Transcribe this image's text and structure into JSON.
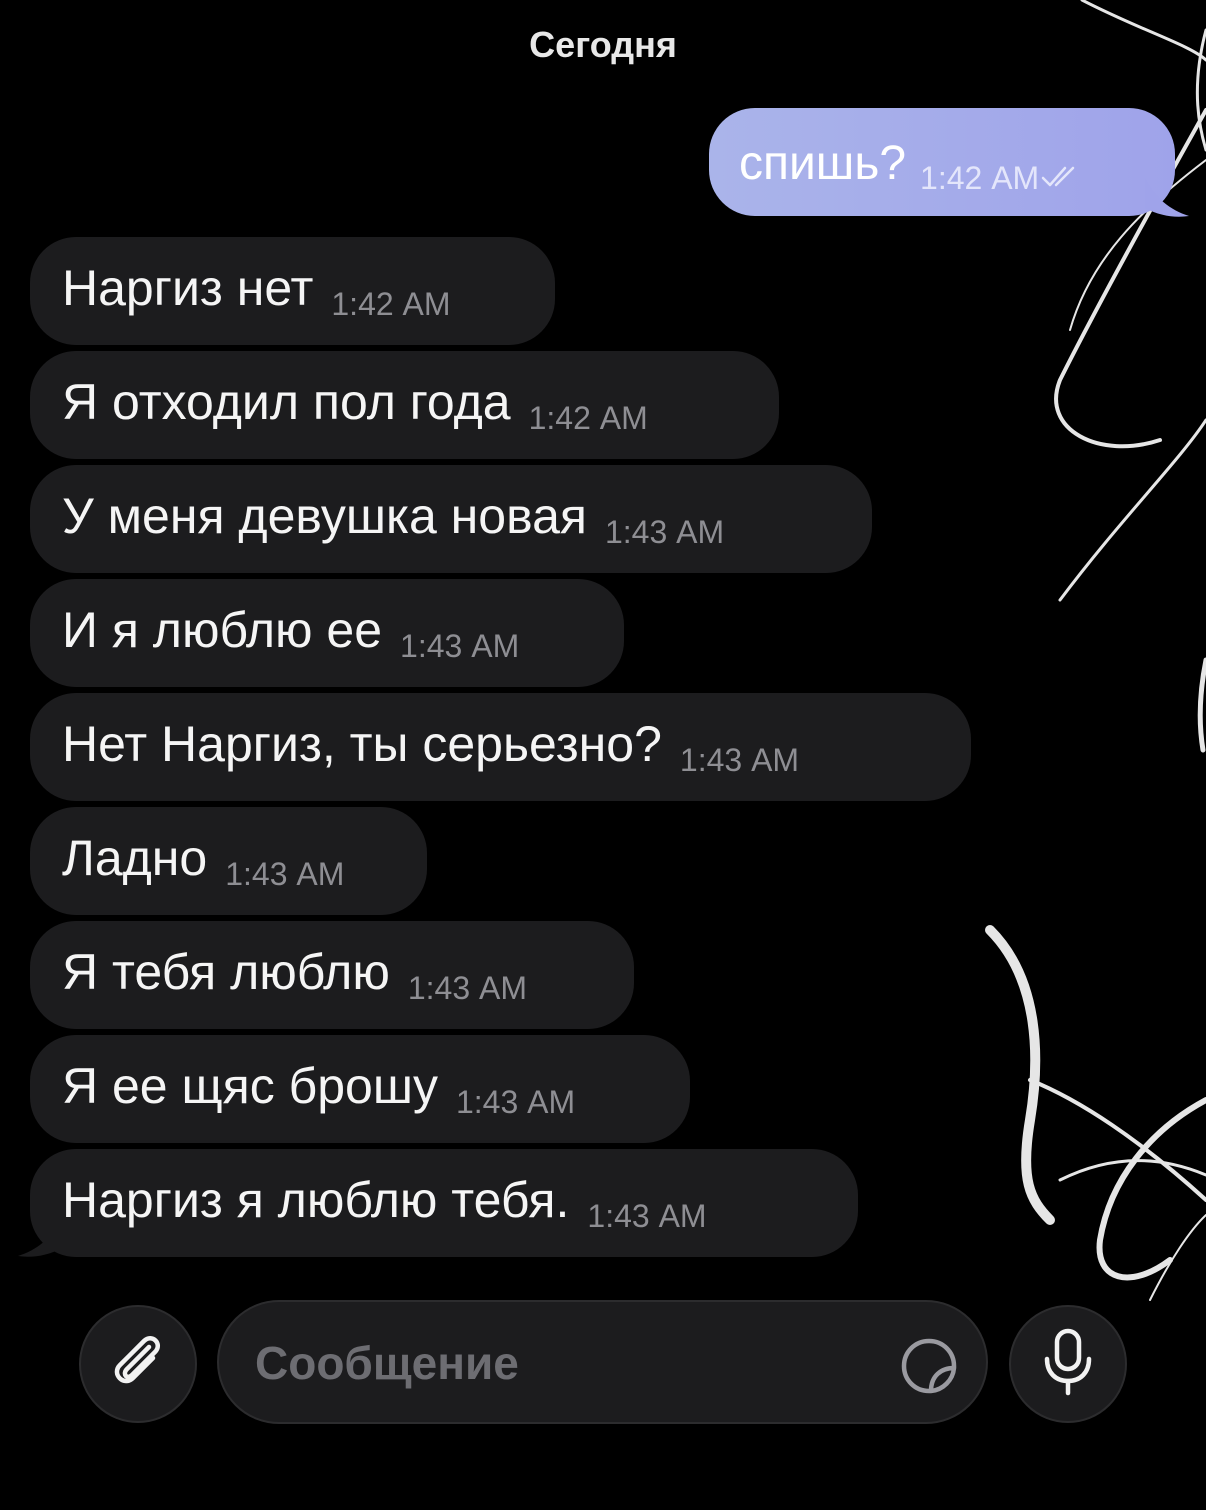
{
  "chat": {
    "date_header": "Сегодня",
    "outgoing": [
      {
        "text": "спишь?",
        "time": "1:42 AM",
        "status": "read"
      }
    ],
    "incoming": [
      {
        "text": "Наргиз нет",
        "time": "1:42 AM"
      },
      {
        "text": "Я отходил пол года",
        "time": "1:42 AM"
      },
      {
        "text": "У меня девушка новая",
        "time": "1:43 AM"
      },
      {
        "text": "И я люблю ее",
        "time": "1:43 AM"
      },
      {
        "text": "Нет Наргиз, ты серьезно?",
        "time": "1:43 AM"
      },
      {
        "text": "Ладно",
        "time": "1:43 AM"
      },
      {
        "text": "Я тебя люблю",
        "time": "1:43 AM"
      },
      {
        "text": "Я ее щяс брошу",
        "time": "1:43 AM"
      },
      {
        "text": "Наргиз я люблю тебя.",
        "time": "1:43 AM"
      }
    ]
  },
  "composer": {
    "placeholder": "Сообщение",
    "attach_icon": "paperclip-icon",
    "sticker_icon": "sticker-icon",
    "mic_icon": "microphone-icon"
  },
  "colors": {
    "background": "#000000",
    "incoming_bubble": "#1c1c1e",
    "outgoing_bubble": "#a5acea",
    "timestamp": "#8e8e93"
  }
}
